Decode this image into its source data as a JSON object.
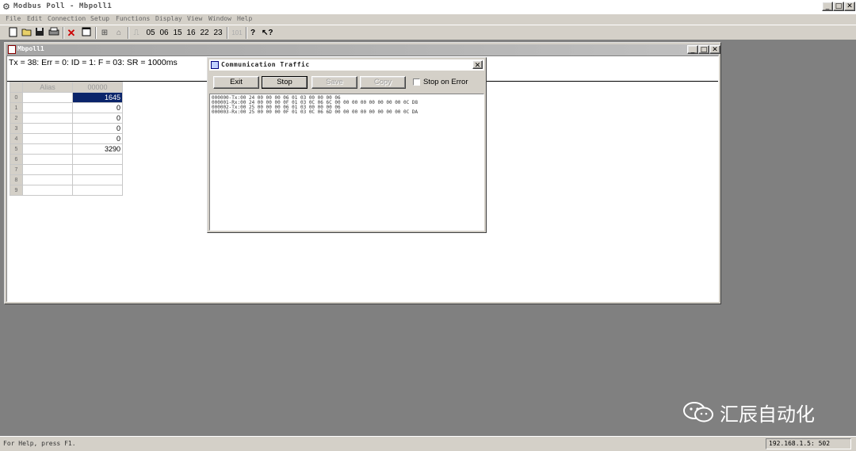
{
  "window": {
    "title": "Modbus Poll - Mbpoll1",
    "icon": "modbus-app-icon"
  },
  "menu": [
    "File",
    "Edit",
    "Connection",
    "Setup",
    "Functions",
    "Display",
    "View",
    "Window",
    "Help"
  ],
  "toolbar": {
    "function_codes": [
      "05",
      "06",
      "15",
      "16",
      "22",
      "23"
    ],
    "disabled_label": "101"
  },
  "child": {
    "title": "Mbpoll1",
    "status": "Tx = 38: Err = 0: ID = 1: F = 03: SR = 1000ms",
    "grid": {
      "headers": [
        "Alias",
        "00000"
      ],
      "rows": [
        {
          "index": "0",
          "alias": "",
          "value": "1645",
          "selected": true
        },
        {
          "index": "1",
          "alias": "",
          "value": "0"
        },
        {
          "index": "2",
          "alias": "",
          "value": "0"
        },
        {
          "index": "3",
          "alias": "",
          "value": "0"
        },
        {
          "index": "4",
          "alias": "",
          "value": "0"
        },
        {
          "index": "5",
          "alias": "",
          "value": "3290"
        },
        {
          "index": "6",
          "alias": "",
          "value": ""
        },
        {
          "index": "7",
          "alias": "",
          "value": ""
        },
        {
          "index": "8",
          "alias": "",
          "value": ""
        },
        {
          "index": "9",
          "alias": "",
          "value": ""
        }
      ]
    }
  },
  "dialog": {
    "title": "Communication Traffic",
    "buttons": {
      "exit": "Exit",
      "stop": "Stop",
      "save": "Save",
      "copy": "Copy"
    },
    "stop_on_error": "Stop on Error",
    "lines": [
      "000000-Tx:00 24 00 00 00 06 01 03 00 00 00 06",
      "000001-Rx:00 24 00 00 00 0F 01 03 0C 06 6C 00 00 00 00 00 00 00 00 0C D8",
      "000002-Tx:00 25 00 00 00 06 01 03 00 00 00 06",
      "000003-Rx:00 25 00 00 00 0F 01 03 0C 06 6D 00 00 00 00 00 00 00 00 0C DA"
    ]
  },
  "statusbar": {
    "help": "For Help, press F1.",
    "address": "192.168.1.5:  502"
  },
  "watermark": {
    "text": "汇辰自动化",
    "icon": "wechat-icon"
  }
}
